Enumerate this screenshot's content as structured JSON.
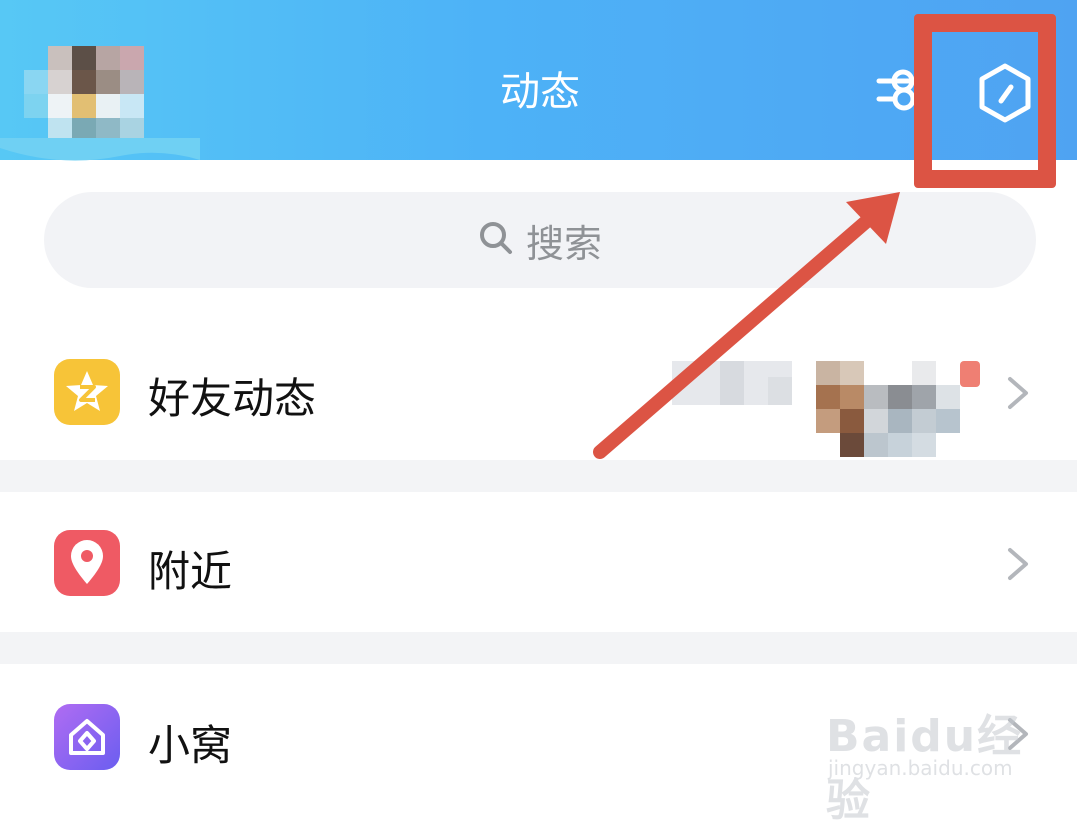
{
  "header": {
    "title": "动态",
    "bg_start": "#57c8f5",
    "bg_end": "#4fa3f2",
    "filter_icon": "filter-toggle-icon",
    "settings_icon": "hexagon-settings-icon"
  },
  "annotation": {
    "color": "#dc5444"
  },
  "search": {
    "placeholder": "搜索",
    "icon": "search-icon"
  },
  "menu": {
    "items": [
      {
        "label": "好友动态",
        "icon": "qzone-star-icon",
        "icon_color": "#f7c438"
      },
      {
        "label": "附近",
        "icon": "location-pin-icon",
        "icon_color": "#ef5a64"
      },
      {
        "label": "小窝",
        "icon": "home-diamond-icon",
        "icon_color": "#8d61f0"
      }
    ]
  },
  "watermark": {
    "logo": "Baidu经验",
    "url": "jingyan.baidu.com"
  }
}
